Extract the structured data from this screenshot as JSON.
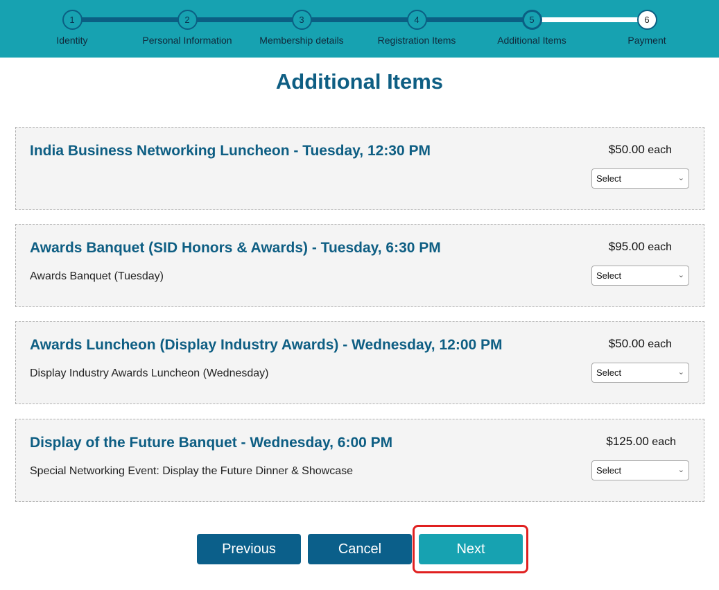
{
  "steps": [
    {
      "num": "1",
      "label": "Identity"
    },
    {
      "num": "2",
      "label": "Personal Information"
    },
    {
      "num": "3",
      "label": "Membership details"
    },
    {
      "num": "4",
      "label": "Registration Items"
    },
    {
      "num": "5",
      "label": "Additional Items"
    },
    {
      "num": "6",
      "label": "Payment"
    }
  ],
  "page_title": "Additional Items",
  "items": [
    {
      "title": "India Business Networking Luncheon - Tuesday, 12:30 PM",
      "description": "",
      "price": "$50.00",
      "unit": "each",
      "select_value": "Select"
    },
    {
      "title": "Awards Banquet (SID Honors & Awards) - Tuesday, 6:30 PM",
      "description": "Awards Banquet (Tuesday)",
      "price": "$95.00",
      "unit": "each",
      "select_value": "Select"
    },
    {
      "title": "Awards Luncheon (Display Industry Awards) - Wednesday, 12:00 PM",
      "description": "Display Industry Awards Luncheon (Wednesday)",
      "price": "$50.00",
      "unit": "each",
      "select_value": "Select"
    },
    {
      "title": "Display of the Future Banquet - Wednesday, 6:00 PM",
      "description": "Special Networking Event: Display the Future Dinner & Showcase",
      "price": "$125.00",
      "unit": "each",
      "select_value": "Select"
    }
  ],
  "buttons": {
    "previous": "Previous",
    "cancel": "Cancel",
    "next": "Next"
  },
  "icons": {
    "select_chevron": "chevron-down-icon"
  },
  "colors": {
    "header_bg": "#17a2b1",
    "accent_dark": "#0b5f8a",
    "title": "#0e5e83",
    "highlight": "#e02020"
  }
}
